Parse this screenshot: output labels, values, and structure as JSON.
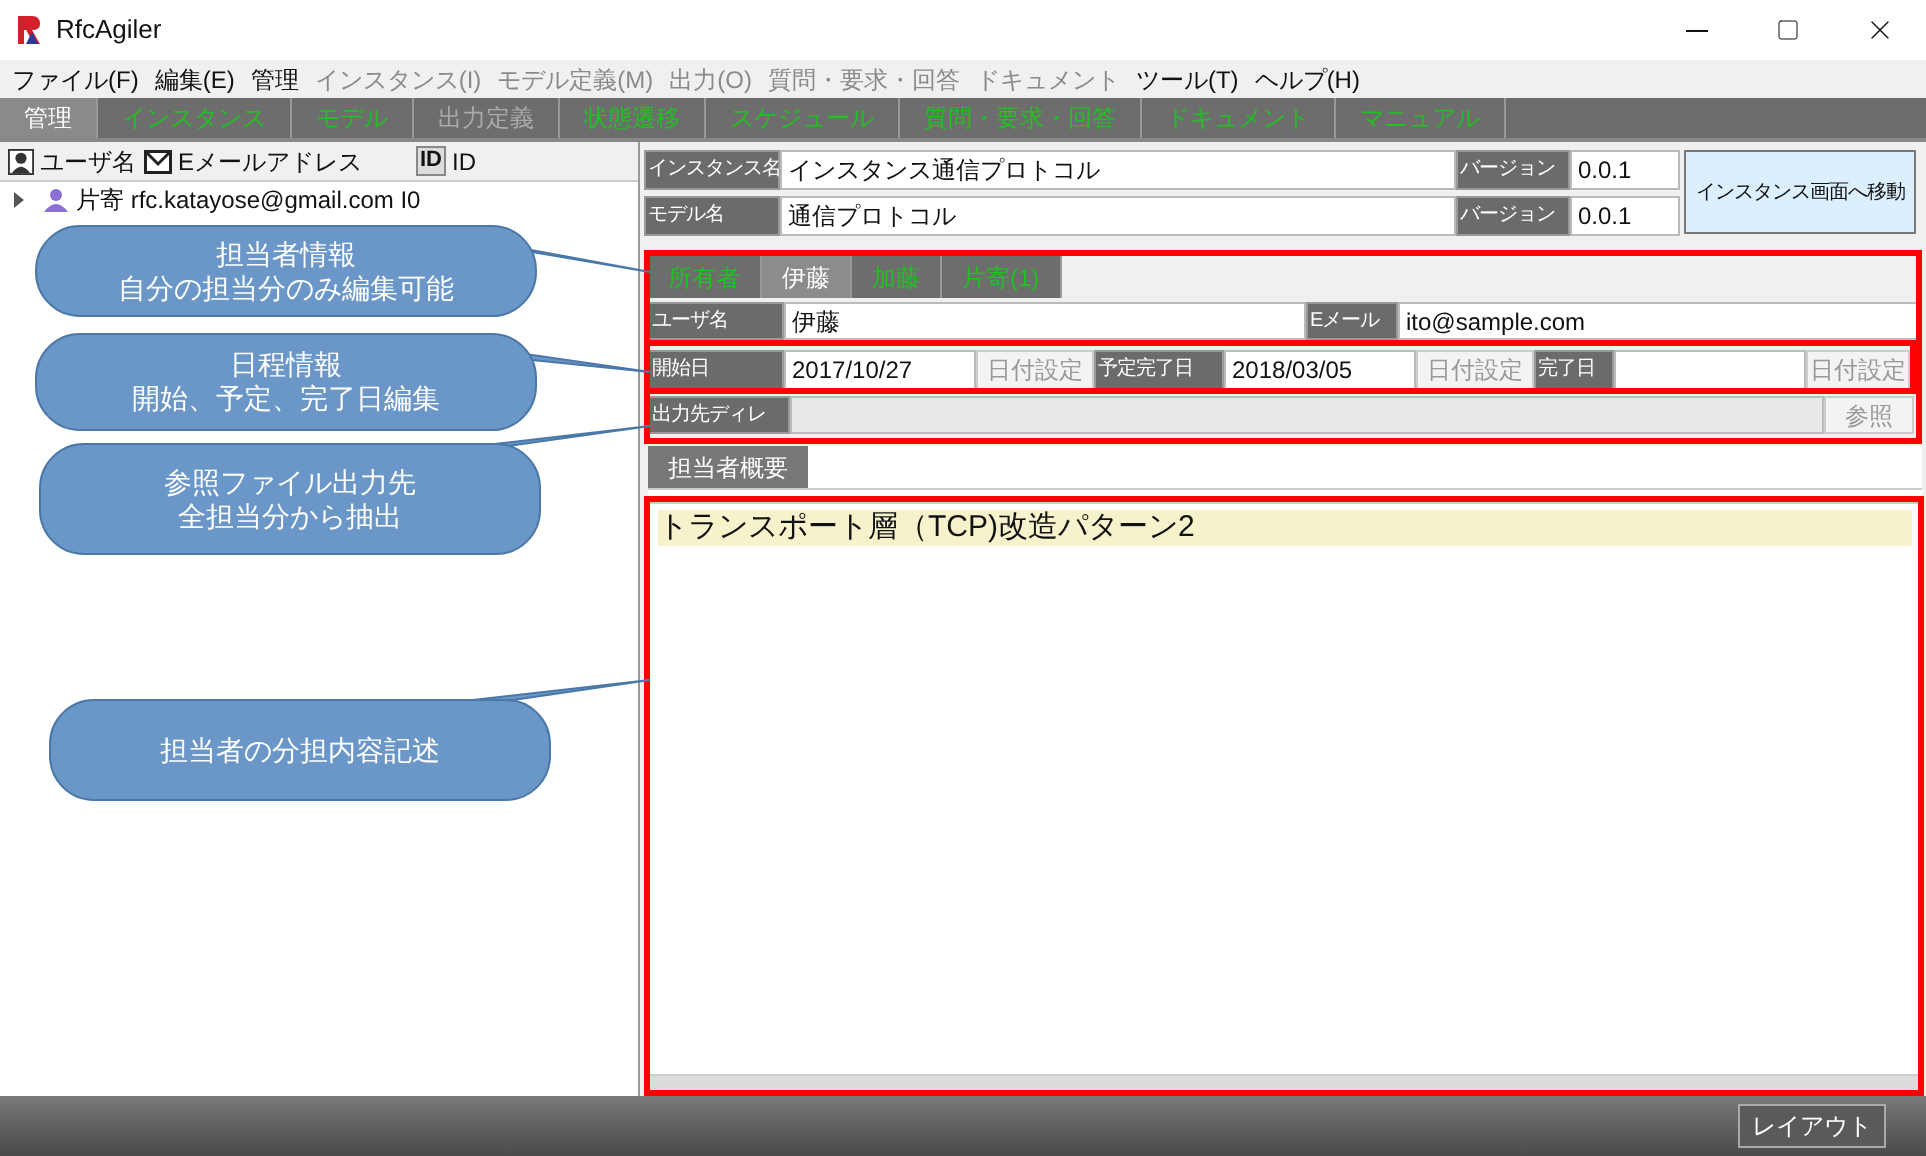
{
  "window": {
    "title": "RfcAgiler"
  },
  "menu": [
    {
      "label": "ファイル(F)",
      "disabled": false
    },
    {
      "label": "編集(E)",
      "disabled": false
    },
    {
      "label": "管理",
      "disabled": false
    },
    {
      "label": "インスタンス(I)",
      "disabled": true
    },
    {
      "label": "モデル定義(M)",
      "disabled": true
    },
    {
      "label": "出力(O)",
      "disabled": true
    },
    {
      "label": "質問・要求・回答",
      "disabled": true
    },
    {
      "label": "ドキュメント",
      "disabled": true
    },
    {
      "label": "ツール(T)",
      "disabled": false
    },
    {
      "label": "ヘルプ(H)",
      "disabled": false
    }
  ],
  "tabs": [
    {
      "label": "管理",
      "selected": true,
      "disabled": false
    },
    {
      "label": "インスタンス",
      "selected": false,
      "disabled": false
    },
    {
      "label": "モデル",
      "selected": false,
      "disabled": false
    },
    {
      "label": "出力定義",
      "selected": false,
      "disabled": true
    },
    {
      "label": "状態遷移",
      "selected": false,
      "disabled": false
    },
    {
      "label": "スケジュール",
      "selected": false,
      "disabled": false
    },
    {
      "label": "質問・要求・回答",
      "selected": false,
      "disabled": false
    },
    {
      "label": "ドキュメント",
      "selected": false,
      "disabled": false
    },
    {
      "label": "マニュアル",
      "selected": false,
      "disabled": false
    }
  ],
  "user_list": {
    "columns": [
      {
        "kind": "user",
        "label": "ユーザ名"
      },
      {
        "kind": "mail",
        "label": "Eメールアドレス"
      },
      {
        "kind": "id",
        "badge": "ID",
        "label": "ID"
      }
    ],
    "rows": [
      {
        "text": "片寄 rfc.katayose@gmail.com I0",
        "expanded": false
      }
    ]
  },
  "header_fields": [
    {
      "label": "インスタンス名",
      "value": "インスタンス通信プロトコル",
      "version_label": "バージョン",
      "version": "0.0.1"
    },
    {
      "label": "モデル名",
      "value": "通信プロトコル",
      "version_label": "バージョン",
      "version": "0.0.1"
    }
  ],
  "goto_button": "インスタンス画面へ移動",
  "member_tabs": [
    {
      "label": "所有者",
      "selected": false
    },
    {
      "label": "伊藤",
      "selected": true
    },
    {
      "label": "加藤",
      "selected": false
    },
    {
      "label": "片寄(1)",
      "selected": false
    }
  ],
  "user_row": {
    "name_label": "ユーザ名",
    "name": "伊藤",
    "email_label": "Eメール",
    "email": "ito@sample.com"
  },
  "dates": [
    {
      "label": "開始日",
      "value": "2017/10/27",
      "button": "日付設定"
    },
    {
      "label": "予定完了日",
      "value": "2018/03/05",
      "button": "日付設定"
    },
    {
      "label": "完了日",
      "button": "日付設定"
    }
  ],
  "output_dir": {
    "label": "出力先ディレ",
    "button": "参照",
    "disabled": true
  },
  "summary_tab": "担当者概要",
  "summary_lines": [
    "トランスポート層（TCP)改造パターン2"
  ],
  "callouts": [
    {
      "lines": [
        "担当者情報",
        "自分の担当分のみ編集可能"
      ]
    },
    {
      "lines": [
        "日程情報",
        "開始、予定、完了日編集"
      ]
    },
    {
      "lines": [
        "参照ファイル出力先",
        "全担当分から抽出"
      ]
    },
    {
      "lines": [
        "担当者の分担内容記述"
      ]
    }
  ],
  "layout_button": "レイアウト"
}
